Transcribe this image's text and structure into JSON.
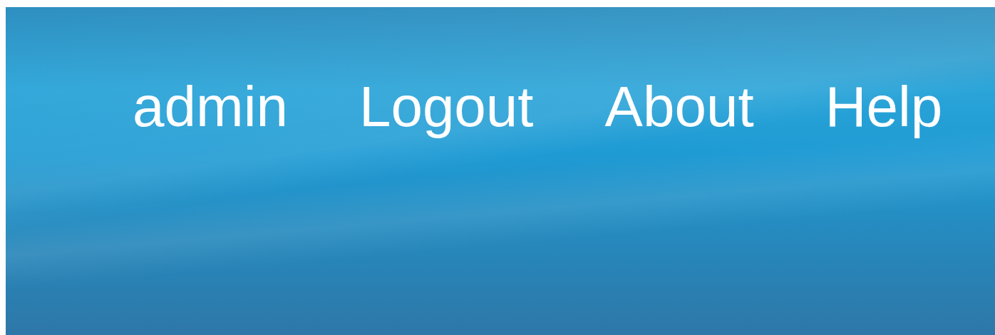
{
  "user": "admin",
  "links": [
    {
      "label": "Logout"
    },
    {
      "label": "About"
    },
    {
      "label": "Help"
    }
  ]
}
